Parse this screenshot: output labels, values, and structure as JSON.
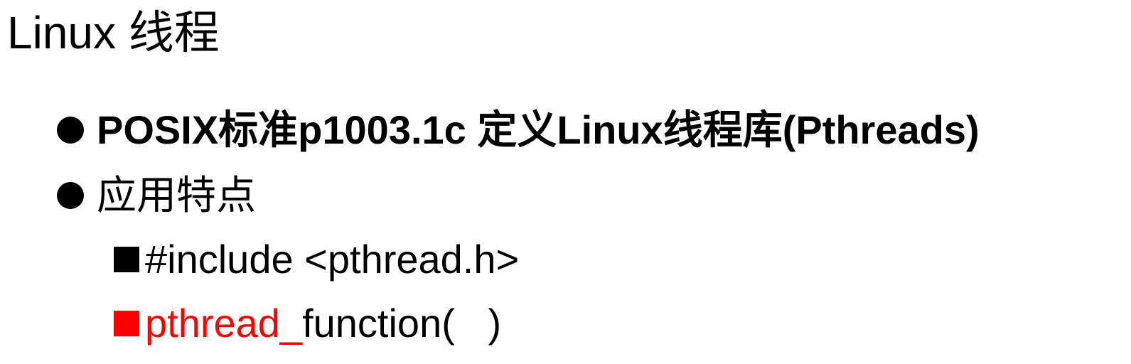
{
  "title": "Linux 线程",
  "bullets": [
    {
      "text": "POSIX标准p1003.1c 定义Linux线程库(Pthreads)",
      "bold": true
    },
    {
      "text": "应用特点",
      "bold": false
    }
  ],
  "sub_items": [
    {
      "text": "#include <pthread.h>"
    },
    {
      "prefix": "pthread_",
      "suffix": "function(   )"
    }
  ],
  "colors": {
    "text": "#000000",
    "highlight": "#ff0000"
  }
}
